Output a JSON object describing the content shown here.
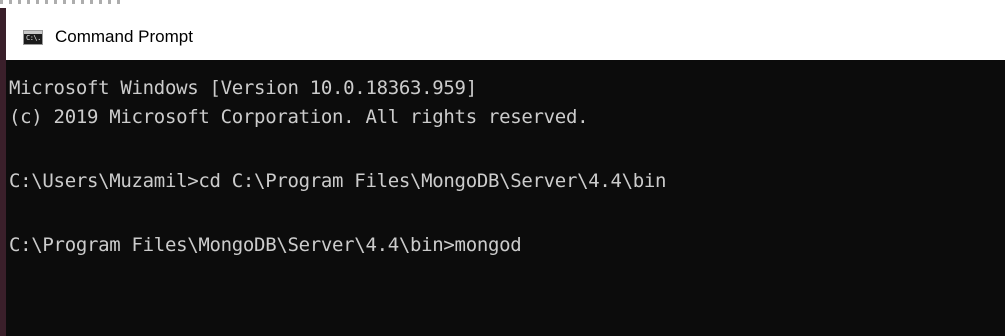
{
  "window": {
    "title": "Command Prompt",
    "icon": "command-prompt-icon",
    "icon_label": "C:\\."
  },
  "console": {
    "lines": [
      "Microsoft Windows [Version 10.0.18363.959]",
      "(c) 2019 Microsoft Corporation. All rights reserved.",
      "C:\\Users\\Muzamil>cd C:\\Program Files\\MongoDB\\Server\\4.4\\bin",
      "C:\\Program Files\\MongoDB\\Server\\4.4\\bin>mongod"
    ]
  },
  "colors": {
    "console_background": "#0c0c0c",
    "console_text": "#cccccc",
    "title_bar_background": "#ffffff",
    "title_text": "#000000"
  }
}
